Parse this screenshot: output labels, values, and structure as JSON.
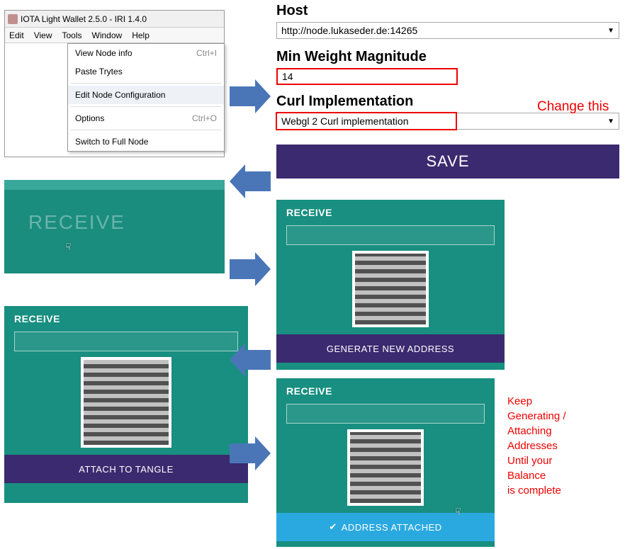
{
  "window": {
    "title": "IOTA Light Wallet 2.5.0 - IRI 1.4.0",
    "menus": {
      "edit": "Edit",
      "view": "View",
      "tools": "Tools",
      "window": "Window",
      "help": "Help"
    },
    "tools_menu": {
      "view_node_info": "View Node info",
      "view_node_info_sc": "Ctrl+I",
      "paste_trytes": "Paste Trytes",
      "edit_node_cfg": "Edit Node Configuration",
      "options": "Options",
      "options_sc": "Ctrl+O",
      "switch_full": "Switch to Full Node"
    }
  },
  "config": {
    "host_label": "Host",
    "host_value": "http://node.lukaseder.de:14265",
    "mwm_label": "Min Weight Magnitude",
    "mwm_value": "14",
    "curl_label": "Curl Implementation",
    "curl_value": "Webgl 2 Curl implementation",
    "change_note": "Change this",
    "save_label": "SAVE"
  },
  "receive": {
    "label": "RECEIVE",
    "gen_new": "GENERATE NEW ADDRESS",
    "attach": "ATTACH TO TANGLE",
    "attached": "ADDRESS ATTACHED"
  },
  "side_note": {
    "l1": "Keep",
    "l2": "Generating /",
    "l3": "Attaching",
    "l4": "Addresses",
    "l5": "Until your",
    "l6": "Balance",
    "l7": "is complete"
  }
}
